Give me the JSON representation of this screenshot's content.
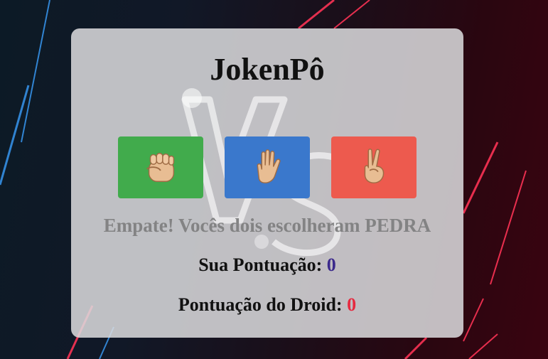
{
  "game": {
    "title": "JokenPô",
    "choices": [
      {
        "name": "rock",
        "icon": "rock-fist-icon",
        "color": "#41ab4c"
      },
      {
        "name": "paper",
        "icon": "paper-hand-icon",
        "color": "#3a78cc"
      },
      {
        "name": "scissors",
        "icon": "scissors-hand-icon",
        "color": "#ed5a4e"
      }
    ],
    "result_message": "Empate! Vocês dois escolheram PEDRA",
    "player_score_label": "Sua Pontuação:",
    "player_score": "0",
    "droid_score_label": "Pontuação do Droid:",
    "droid_score": "0"
  },
  "colors": {
    "player_score": "#3c2a8c",
    "droid_score": "#e62a40",
    "card_background": "#dcdcde"
  }
}
